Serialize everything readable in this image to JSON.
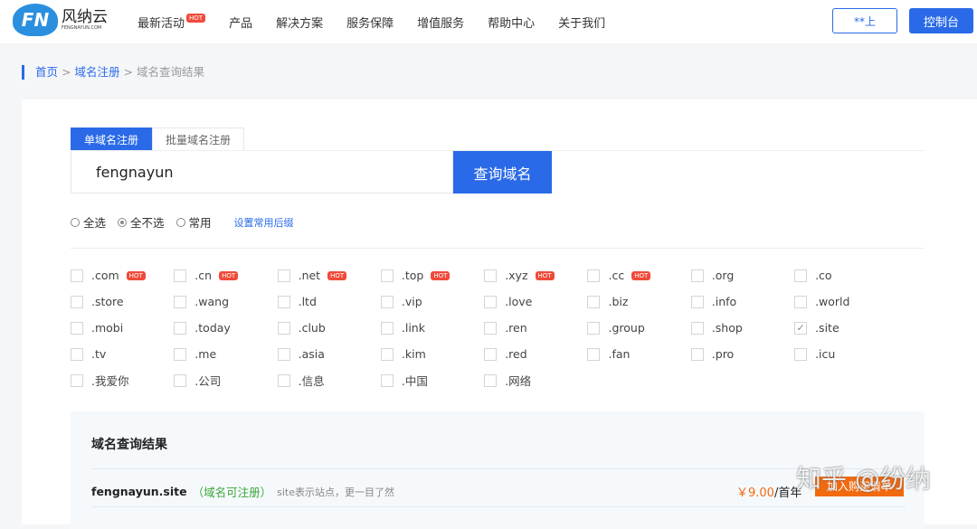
{
  "logo": {
    "cn": "风纳云",
    "en": "FENGNAYUN.COM",
    "mark": "FN"
  },
  "nav": [
    {
      "label": "最新活动",
      "badge": "HOT"
    },
    {
      "label": "产品"
    },
    {
      "label": "解决方案"
    },
    {
      "label": "服务保障"
    },
    {
      "label": "增值服务"
    },
    {
      "label": "帮助中心"
    },
    {
      "label": "关于我们"
    }
  ],
  "header": {
    "login": "**上",
    "console": "控制台"
  },
  "breadcrumb": {
    "home": "首页",
    "sep": ">",
    "reg": "域名注册",
    "current": "域名查询结果"
  },
  "tabs": [
    "单域名注册",
    "批量域名注册"
  ],
  "search": {
    "value": "fengnayun",
    "button": "查询域名"
  },
  "radios": [
    {
      "label": "全选",
      "checked": false
    },
    {
      "label": "全不选",
      "checked": true
    },
    {
      "label": "常用",
      "checked": false
    }
  ],
  "set_common": "设置常用后缀",
  "suffixes": [
    {
      "n": ".com",
      "hot": true
    },
    {
      "n": ".cn",
      "hot": true
    },
    {
      "n": ".net",
      "hot": true
    },
    {
      "n": ".top",
      "hot": true
    },
    {
      "n": ".xyz",
      "hot": true
    },
    {
      "n": ".cc",
      "hot": true
    },
    {
      "n": ".org"
    },
    {
      "n": ".co"
    },
    {
      "n": ".store"
    },
    {
      "n": ".wang"
    },
    {
      "n": ".ltd"
    },
    {
      "n": ".vip"
    },
    {
      "n": ".love"
    },
    {
      "n": ".biz"
    },
    {
      "n": ".info"
    },
    {
      "n": ".world"
    },
    {
      "n": ".mobi"
    },
    {
      "n": ".today"
    },
    {
      "n": ".club"
    },
    {
      "n": ".link"
    },
    {
      "n": ".ren"
    },
    {
      "n": ".group"
    },
    {
      "n": ".shop"
    },
    {
      "n": ".site",
      "checked": true
    },
    {
      "n": ".tv"
    },
    {
      "n": ".me"
    },
    {
      "n": ".asia"
    },
    {
      "n": ".kim"
    },
    {
      "n": ".red"
    },
    {
      "n": ".fan"
    },
    {
      "n": ".pro"
    },
    {
      "n": ".icu"
    },
    {
      "n": ".我爱你"
    },
    {
      "n": ".公司"
    },
    {
      "n": ".信息"
    },
    {
      "n": ".中国"
    },
    {
      "n": ".网络"
    }
  ],
  "hot_label": "HOT",
  "result": {
    "title": "域名查询结果",
    "domain": "fengnayun.site",
    "status": "（域名可注册）",
    "desc": "site表示站点，更一目了然",
    "price": "￥9.00",
    "unit": "/首年",
    "buy": "加入购买清单"
  },
  "watermark": "知乎 @纷纳"
}
